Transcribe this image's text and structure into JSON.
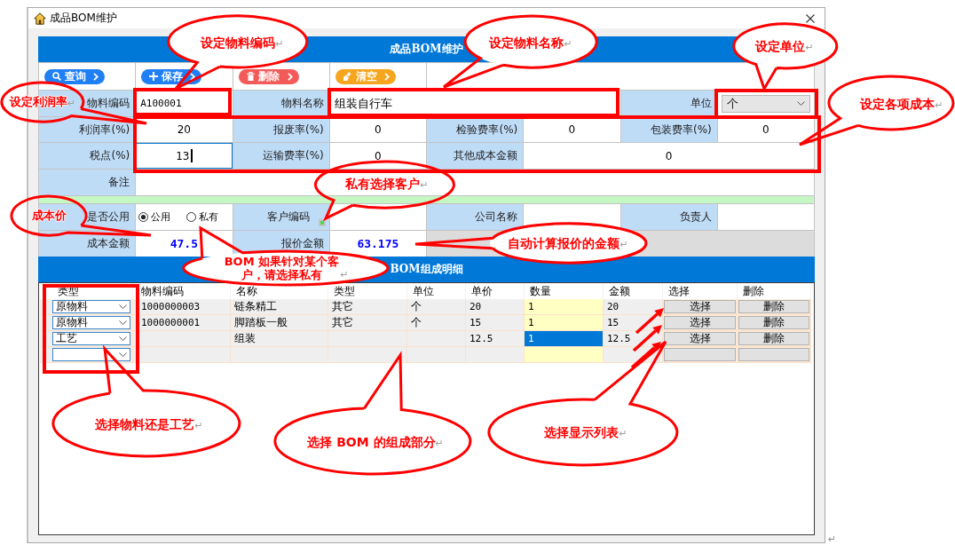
{
  "window": {
    "title": "成品BOM维护"
  },
  "form": {
    "title": "成品BOM维护",
    "toolbar": [
      {
        "kind": "search",
        "label": "查询"
      },
      {
        "kind": "save",
        "label": "保存"
      },
      {
        "kind": "delete",
        "label": "删除"
      },
      {
        "kind": "clear",
        "label": "清空"
      }
    ],
    "material": {
      "code": {
        "label": "物料编码",
        "value": "A100001"
      },
      "name": {
        "label": "物料名称",
        "value": "组装自行车"
      },
      "unit": {
        "label": "单位",
        "value": "个"
      }
    },
    "costs": [
      {
        "label": "利润率(%)",
        "value": "20",
        "focused": false
      },
      {
        "label": "报废率(%)",
        "value": "0",
        "focused": false
      },
      {
        "label": "检验费率(%)",
        "value": "0",
        "focused": false
      },
      {
        "label": "包装费率(%)",
        "value": "0",
        "focused": false
      },
      {
        "label": "税点(%)",
        "value": "13",
        "focused": true
      },
      {
        "label": "运输费率(%)",
        "value": "0",
        "focused": false
      },
      {
        "label": "其他成本金额",
        "value": "0",
        "focused": false
      }
    ],
    "remark": {
      "label": "备注"
    },
    "sharing": {
      "label": "是否公用",
      "options": [
        {
          "label": "公用",
          "selected": true
        },
        {
          "label": "私有",
          "selected": false
        }
      ]
    },
    "customer_code": {
      "label": "客户编码"
    },
    "company_name": {
      "label": "公司名称"
    },
    "owner": {
      "label": "负责人"
    },
    "cost_amount": {
      "label": "成本金额",
      "value": "47.5"
    },
    "quote_amount": {
      "label": "报价金额",
      "value": "63.175"
    }
  },
  "bom": {
    "title": "BOM组成明细",
    "columns": [
      "类型",
      "物料编码",
      "名称",
      "类型",
      "单位",
      "单价",
      "数量",
      "金额",
      "选择",
      "删除"
    ],
    "rows": [
      {
        "type": "原物料",
        "code": "1000000003",
        "name": "链条精工",
        "category": "其它",
        "unit": "个",
        "price": "20",
        "quantity": "1",
        "amount": "20",
        "select": "选择",
        "delete": "删除",
        "selected": false
      },
      {
        "type": "原物料",
        "code": "1000000001",
        "name": "脚踏板一般",
        "category": "其它",
        "unit": "个",
        "price": "15",
        "quantity": "1",
        "amount": "15",
        "select": "选择",
        "delete": "删除",
        "selected": false
      },
      {
        "type": "工艺",
        "name": "组装",
        "price": "12.5",
        "quantity": "1",
        "amount": "12.5",
        "select": "选择",
        "delete": "删除",
        "selected": true
      },
      {
        "selected": false
      }
    ]
  },
  "annotations": [
    {
      "text": "设定物料编码",
      "mark": "↵"
    },
    {
      "text": "设定物料名称",
      "mark": "↵"
    },
    {
      "text": "设定单位",
      "mark": "↵"
    },
    {
      "text": "设定利润率",
      "mark": "↵"
    },
    {
      "text": "设定各项成本",
      "mark": "↵"
    },
    {
      "text": "私有选择客户",
      "mark": "↵"
    },
    {
      "text": "成本价"
    },
    {
      "text": "自动计算报价的金额",
      "mark": "↵"
    },
    {
      "text": "BOM 如果针对某个客户，请选择私有",
      "mark": "↵"
    },
    {
      "text": "选择物料还是工艺",
      "mark": "↵"
    },
    {
      "text": "选择 BOM 的组成部分",
      "mark": "↵"
    },
    {
      "text": "选择显示列表",
      "mark": "↵"
    }
  ],
  "trailing_mark": "↵"
}
